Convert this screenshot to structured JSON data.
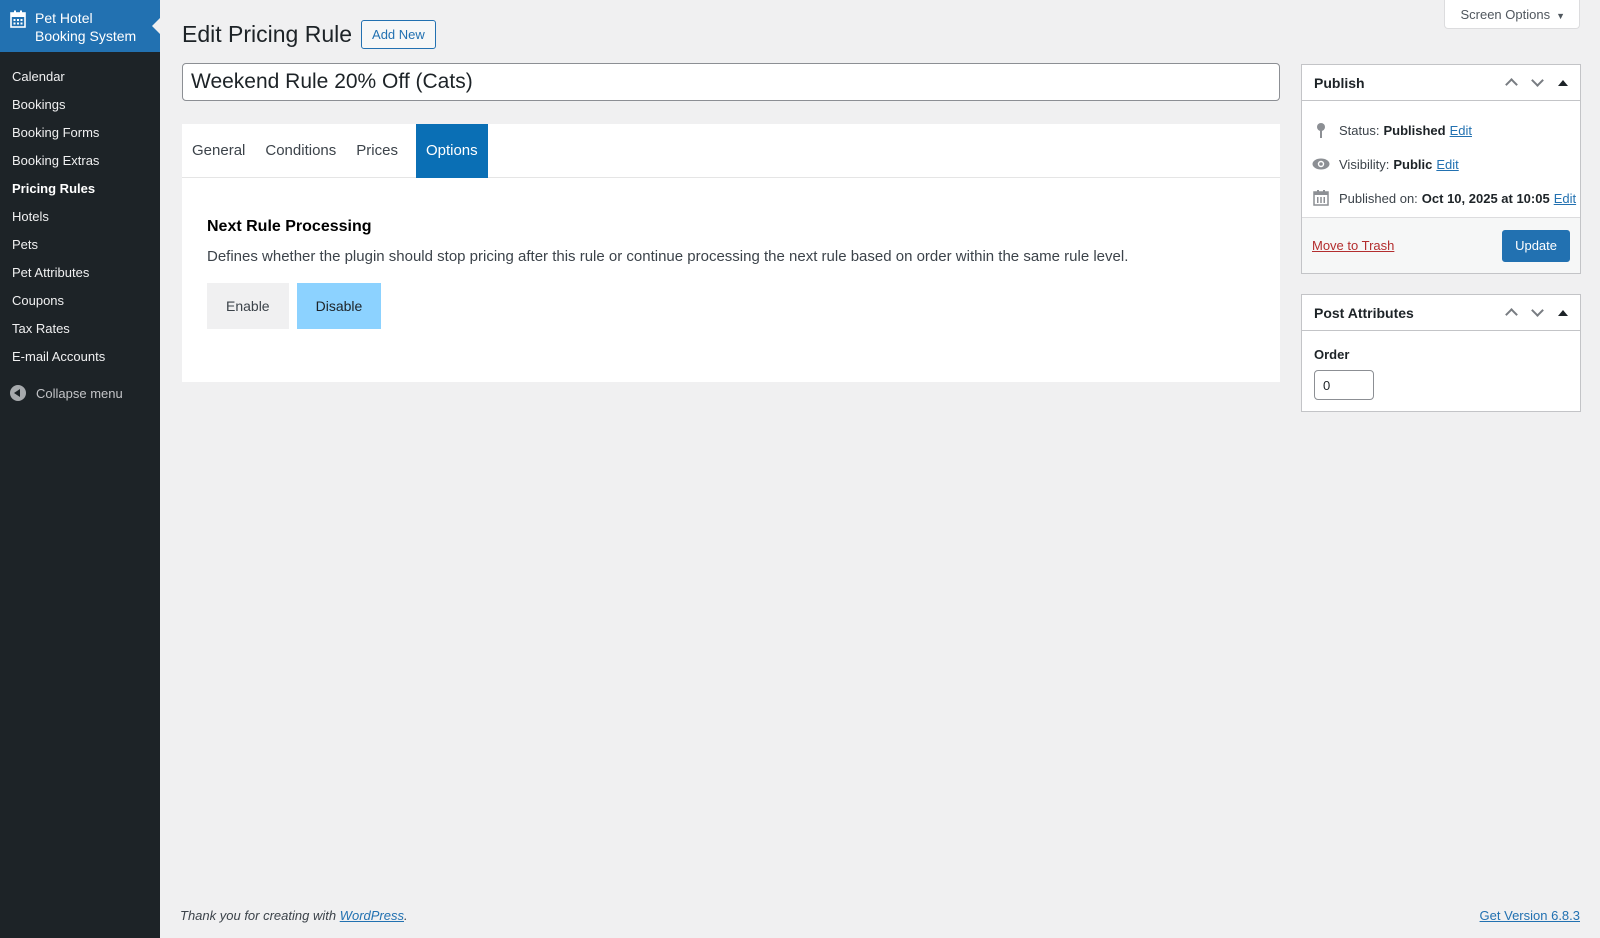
{
  "sidebar": {
    "brand_line1": "Pet Hotel",
    "brand_line2": "Booking System",
    "items": [
      {
        "label": "Calendar"
      },
      {
        "label": "Bookings"
      },
      {
        "label": "Booking Forms"
      },
      {
        "label": "Booking Extras"
      },
      {
        "label": "Pricing Rules"
      },
      {
        "label": "Hotels"
      },
      {
        "label": "Pets"
      },
      {
        "label": "Pet Attributes"
      },
      {
        "label": "Coupons"
      },
      {
        "label": "Tax Rates"
      },
      {
        "label": "E-mail Accounts"
      }
    ],
    "current_item": "Pricing Rules",
    "collapse_label": "Collapse menu"
  },
  "header": {
    "screen_options": "Screen Options",
    "title": "Edit Pricing Rule",
    "add_new": "Add New"
  },
  "post_title": "Weekend Rule 20% Off (Cats)",
  "tabs": [
    {
      "label": "General"
    },
    {
      "label": "Conditions"
    },
    {
      "label": "Prices"
    },
    {
      "label": "Options"
    }
  ],
  "active_tab": "Options",
  "options": {
    "heading": "Next Rule Processing",
    "description": "Defines whether the plugin should stop pricing after this rule or continue processing the next rule based on order within the same rule level.",
    "enable_label": "Enable",
    "disable_label": "Disable",
    "selected": "Disable"
  },
  "publish": {
    "title": "Publish",
    "status_label": "Status:",
    "status_value": "Published",
    "visibility_label": "Visibility:",
    "visibility_value": "Public",
    "published_label": "Published on:",
    "published_value": "Oct 10, 2025 at 10:05",
    "edit_label": "Edit",
    "trash_label": "Move to Trash",
    "update_label": "Update"
  },
  "post_attributes": {
    "title": "Post Attributes",
    "order_label": "Order",
    "order_value": "0"
  },
  "footer": {
    "thanks_prefix": "Thank you for creating with",
    "wp_link": "WordPress",
    "thanks_suffix": ".",
    "version_link": "Get Version 6.8.3"
  },
  "colors": {
    "admin_bar": "#1d2327",
    "accent": "#2271b1",
    "active_tab": "#0a6fb5",
    "selected_toggle": "#8cd2ff",
    "trash": "#b32d2e"
  }
}
